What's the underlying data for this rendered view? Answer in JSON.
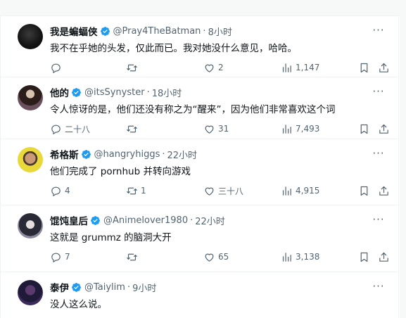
{
  "colors": {
    "accent": "#1d9bf0",
    "muted": "#536471",
    "text": "#0f1419"
  },
  "tweets": [
    {
      "name": "我是蝙蝠侠",
      "handle": "@Pray4TheBatman",
      "sep": "·",
      "time": "8小时",
      "text": "我不在乎她的头发，仅此而已。我对她没什么意见，哈哈。",
      "reply_count": "",
      "retweet_count": "",
      "like_count": "2",
      "view_count": "1,147"
    },
    {
      "name": "他的",
      "handle": "@itsSynyster",
      "sep": "·",
      "time": "18小时",
      "text": "令人惊讶的是，他们还没有称之为“醒来”，因为他们非常喜欢这个词",
      "reply_count": "二十八",
      "retweet_count": "",
      "like_count": "31",
      "view_count": "7,493"
    },
    {
      "name": "希格斯",
      "handle": "@hangryhiggs",
      "sep": "·",
      "time": "22小时",
      "text": "他们完成了 pornhub 并转向游戏",
      "reply_count": "4",
      "retweet_count": "1",
      "like_count": "三十八",
      "view_count": "4,915"
    },
    {
      "name": "馄饨皇后",
      "handle": "@Animelover1980",
      "sep": "·",
      "time": "22小时",
      "text": "这就是 grummz 的脑洞大开",
      "reply_count": "7",
      "retweet_count": "",
      "like_count": "65",
      "view_count": "3,138"
    },
    {
      "name": "泰伊",
      "handle": "@Taiylim",
      "sep": "·",
      "time": "9小时",
      "text": "没人这么说。",
      "reply_count": "",
      "retweet_count": "",
      "like_count": "",
      "view_count": ""
    }
  ]
}
